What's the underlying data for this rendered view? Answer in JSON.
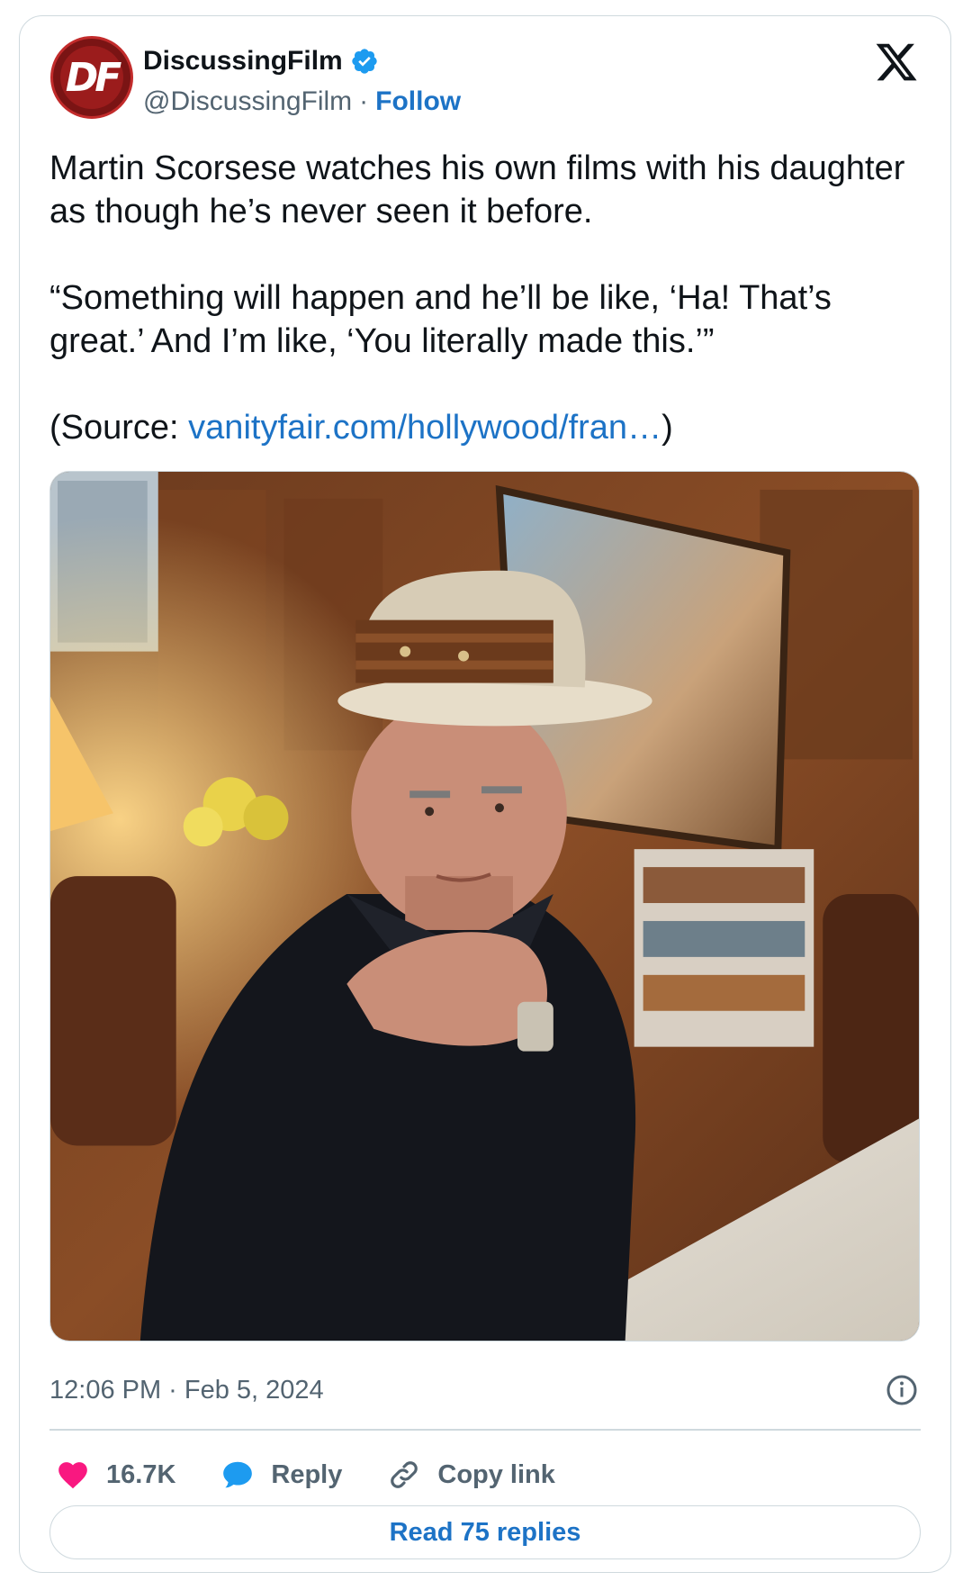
{
  "author": {
    "display_name": "DiscussingFilm",
    "handle": "@DiscussingFilm",
    "separator": "·",
    "follow_label": "Follow",
    "avatar_text": "DF",
    "verified": true
  },
  "tweet": {
    "line1": "Martin Scorsese watches his own films with his daughter as though he’s never seen it before.",
    "quote": "“Something will happen and he’ll be like, ‘Ha! That’s great.’ And I’m like, ‘You literally made this.’”",
    "source_prefix": "(Source: ",
    "source_link": "vanityfair.com/hollywood/fran…",
    "source_suffix": ")"
  },
  "meta": {
    "timestamp": "12:06 PM · Feb 5, 2024"
  },
  "actions": {
    "like_count": "16.7K",
    "reply_label": "Reply",
    "copy_label": "Copy link"
  },
  "footer": {
    "read_replies_label": "Read 75 replies"
  },
  "colors": {
    "link": "#1d73c6",
    "like": "#f91880",
    "reply": "#1d9bf0",
    "verified": "#1d9bf0",
    "border": "#cfd9de",
    "muted": "#536471"
  },
  "icons": [
    "x-logo-icon",
    "verified-badge-icon",
    "info-icon",
    "heart-icon",
    "reply-bubble-icon",
    "link-icon"
  ]
}
